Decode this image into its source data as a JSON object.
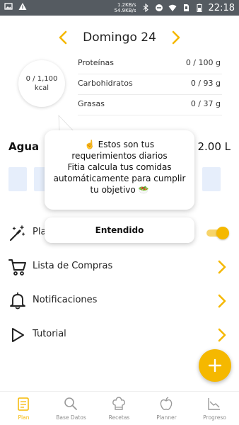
{
  "status_bar": {
    "speed_up": "1.2KB/s",
    "speed_down": "54.9KB/s",
    "time": "22:18"
  },
  "date_header": {
    "title": "Domingo 24"
  },
  "calories": {
    "value": "0 / 1,100",
    "unit": "kcal"
  },
  "macros": [
    {
      "name": "Proteínas",
      "value": "0 / 100 g"
    },
    {
      "name": "Carbohidratos",
      "value": "0 / 93 g"
    },
    {
      "name": "Grasas",
      "value": "0 / 37 g"
    }
  ],
  "water": {
    "title": "Agua",
    "value_visible": "0 / 2.00 L"
  },
  "menu": {
    "plan_label_visible": "Pla",
    "shopping_list": "Lista de Compras",
    "notifications": "Notificaciones",
    "tutorial": "Tutorial"
  },
  "tooltip": {
    "line1": "☝️ Estos son tus requerimientos diarios",
    "line2": "Fitia calcula tus comidas automáticamente para cumplir tu objetivo 🥗",
    "button": "Entendido"
  },
  "bottom_nav": [
    {
      "label": "Plan",
      "icon": "plan-icon",
      "active": true
    },
    {
      "label": "Base Datos",
      "icon": "search-icon",
      "active": false
    },
    {
      "label": "Recetas",
      "icon": "chef-hat-icon",
      "active": false
    },
    {
      "label": "Planner",
      "icon": "apple-icon",
      "active": false
    },
    {
      "label": "Progreso",
      "icon": "chart-icon",
      "active": false
    }
  ],
  "colors": {
    "accent": "#f5b800",
    "status_bar": "#555b61",
    "water_glass": "#e6eefb"
  }
}
